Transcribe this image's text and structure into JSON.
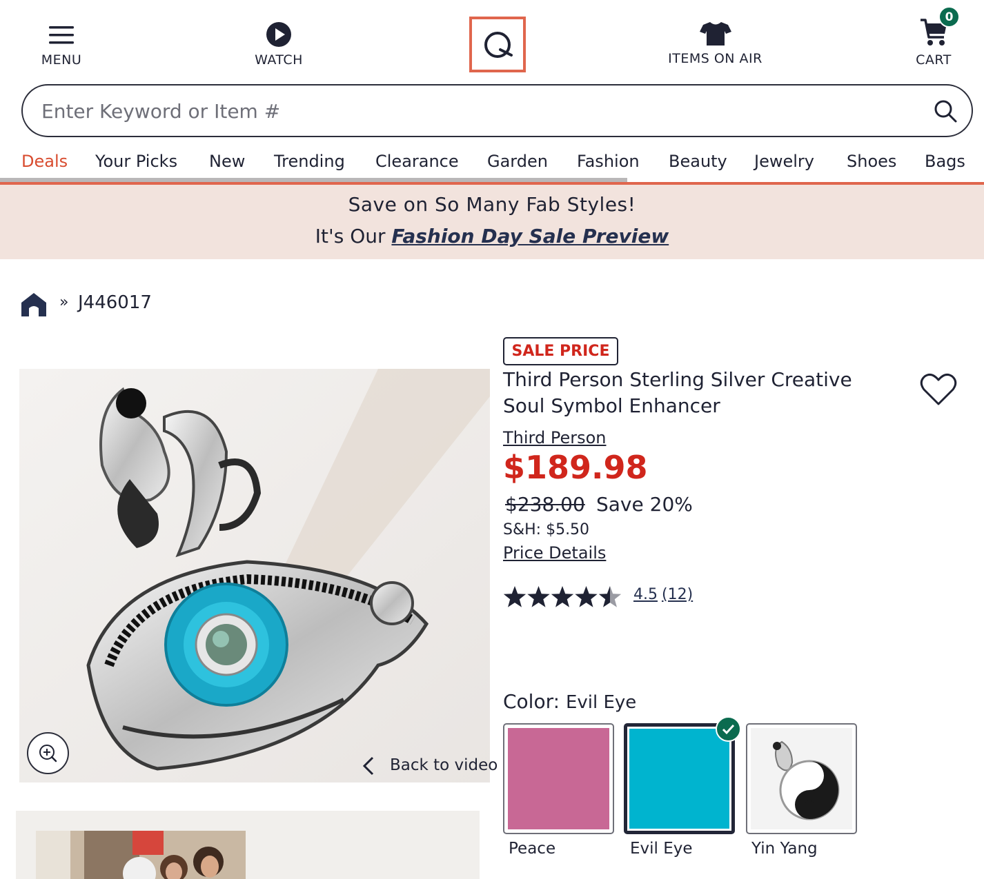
{
  "header": {
    "menu_label": "MENU",
    "watch_label": "WATCH",
    "items_on_air_label": "ITEMS ON AIR",
    "cart_label": "CART",
    "cart_count": "0"
  },
  "search": {
    "placeholder": "Enter Keyword or Item #"
  },
  "nav": {
    "items": [
      "Deals",
      "Your Picks",
      "New",
      "Trending",
      "Clearance",
      "Garden",
      "Fashion",
      "Beauty",
      "Jewelry",
      "Shoes",
      "Bags"
    ],
    "active": "Deals"
  },
  "banner": {
    "line1": "Save on So Many Fab Styles!",
    "line2_prefix": "It's Our",
    "line2_link": "Fashion Day Sale Preview"
  },
  "breadcrumb": {
    "separator": "»",
    "item_id": "J446017"
  },
  "product": {
    "sale_tag": "SALE PRICE",
    "title": "Third Person Sterling Silver Creative Soul Symbol Enhancer",
    "brand": "Third Person",
    "price": "$189.98",
    "original_price": "$238.00",
    "savings": "Save 20%",
    "shipping": "S&H: $5.50",
    "price_details_link": "Price Details",
    "rating_value": "4.5",
    "rating_count": "(12)",
    "rating_stars": 4.5,
    "back_to_video": "Back to video"
  },
  "color": {
    "label": "Color:",
    "selected": "Evil Eye",
    "options": [
      {
        "name": "Peace",
        "swatch": "#c86895"
      },
      {
        "name": "Evil Eye",
        "swatch": "#00b4cf"
      },
      {
        "name": "Yin Yang",
        "swatch": "image"
      }
    ]
  },
  "colors": {
    "accent": "#e0664d",
    "sale_red": "#d0261c",
    "text_dark": "#1f2233",
    "banner_bg": "#f2e3dd",
    "check_green": "#0b6b4f"
  }
}
